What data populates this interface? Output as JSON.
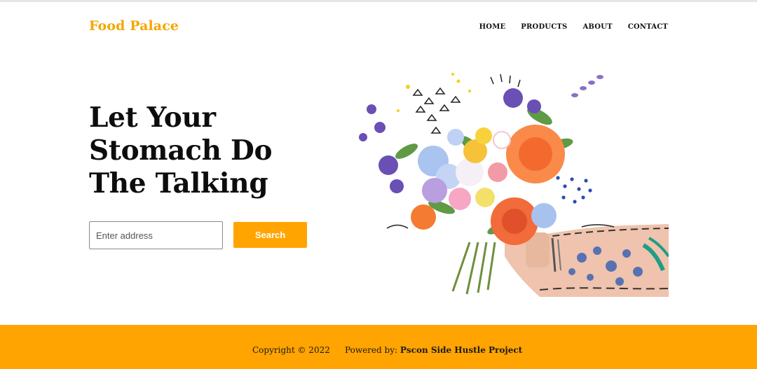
{
  "brand": {
    "name": "Food Palace",
    "color": "#f5a700"
  },
  "nav": {
    "items": [
      "HOME",
      "PRODUCTS",
      "ABOUT",
      "CONTACT"
    ]
  },
  "hero": {
    "title": "Let Your Stomach Do The Talking",
    "address_placeholder": "Enter address",
    "address_value": "",
    "search_label": "Search",
    "image": "flower-bouquet-in-tattooed-arm-illustration"
  },
  "footer": {
    "copyright": "Copyright © 2022",
    "powered_prefix": "Powered by:",
    "powered_name": "Pscon Side Hustle Project",
    "color": "#ffa400"
  }
}
